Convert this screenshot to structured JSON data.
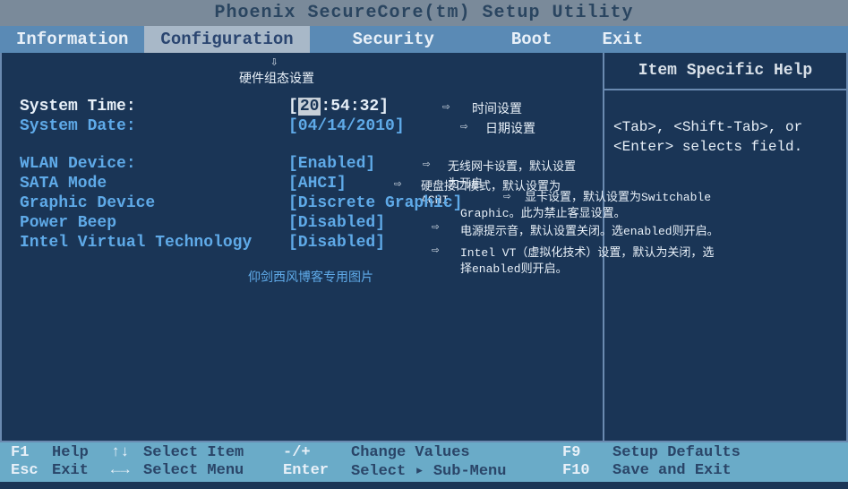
{
  "title": "Phoenix  SecureCore(tm)  Setup Utility",
  "menu": {
    "items": [
      "Information",
      "Configuration",
      "Security",
      "Boot",
      "Exit"
    ],
    "active_index": 1
  },
  "annotations": {
    "down_arrow": "⇩",
    "hardware": "硬件组态设置",
    "time": "时间设置",
    "date": "日期设置",
    "wlan": "无线网卡设置，默认设置为开启",
    "sata": "硬盘接口模式，默认设置为ACHI",
    "graphic1": "显卡设置，默认设置为Switchable",
    "graphic2": "Graphic。此为禁止客显设置。",
    "power": "电源提示音，默认设置关闭。选enabled则开启。",
    "intel1": "Intel VT（虚拟化技术）设置，默认为关闭，选",
    "intel2": "择enabled则开启。",
    "watermark": "仰剑西风博客专用图片"
  },
  "config": {
    "system_time": {
      "label": "System Time:",
      "hour": "20",
      "rest": ":54:32]"
    },
    "system_date": {
      "label": "System Date:",
      "value": "[04/14/2010]"
    },
    "wlan": {
      "label": "WLAN Device:",
      "value": "[Enabled]"
    },
    "sata": {
      "label": "SATA Mode",
      "value": "[AHCI]"
    },
    "graphic": {
      "label": "Graphic Device",
      "value": "[Discrete Graphic]"
    },
    "power": {
      "label": "Power Beep",
      "value": "[Disabled]"
    },
    "intel": {
      "label": "Intel Virtual Technology",
      "value": "[Disabled]"
    }
  },
  "help_panel": {
    "title": "Item Specific Help",
    "line1": "<Tab>, <Shift-Tab>, or",
    "line2": "<Enter> selects field."
  },
  "footer": {
    "r1": {
      "k1": "F1",
      "l1": "Help",
      "s1": "↑↓",
      "l2": "Select Item",
      "s2": "-/+",
      "l3": "Change Values",
      "k2": "F9",
      "l4": "Setup Defaults"
    },
    "r2": {
      "k1": "Esc",
      "l1": "Exit",
      "s1": "←→",
      "l2": "Select Menu",
      "s2": "Enter",
      "l3": "Select ▸ Sub-Menu",
      "k2": "F10",
      "l4": "Save and Exit"
    }
  }
}
